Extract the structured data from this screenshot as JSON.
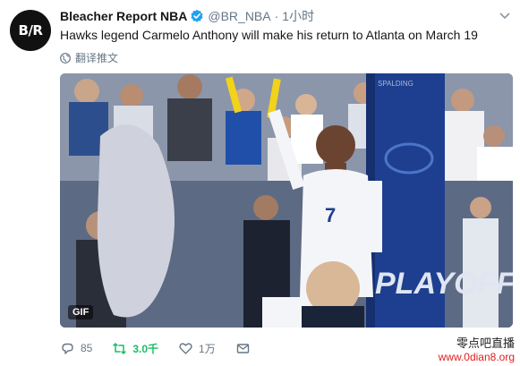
{
  "user": {
    "avatar_text": "B/R",
    "display_name": "Bleacher Report NBA",
    "handle": "@BR_NBA",
    "separator": "·",
    "time": "1小时"
  },
  "tweet": {
    "text": "Hawks legend Carmelo Anthony will make his return to Atlanta on March 19",
    "translate_label": "翻译推文"
  },
  "media": {
    "badge": "GIF",
    "playoffs_text": "PLAYOFFS",
    "jersey_number": "7",
    "spaldings_text": "SPALDING"
  },
  "actions": {
    "reply_count": "85",
    "retweet_count": "3.0千",
    "like_count": "1万"
  },
  "watermark": {
    "line1": "零点吧直播",
    "line2": "www.0dian8.org"
  },
  "colors": {
    "verified": "#1da1f2",
    "retweet": "#17bf63",
    "secondary_text": "#657786",
    "watermark_red": "#e02020"
  }
}
